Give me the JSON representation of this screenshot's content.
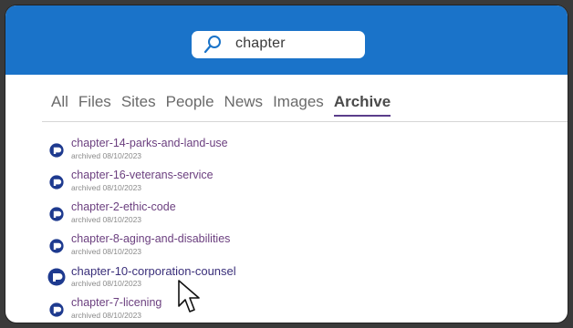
{
  "search": {
    "query": "chapter"
  },
  "tabs": [
    {
      "label": "All"
    },
    {
      "label": "Files"
    },
    {
      "label": "Sites"
    },
    {
      "label": "People"
    },
    {
      "label": "News"
    },
    {
      "label": "Images"
    },
    {
      "label": "Archive",
      "active": true
    }
  ],
  "results": [
    {
      "title": "chapter-14-parks-and-land-use",
      "meta": "archived 08/10/2023"
    },
    {
      "title": "chapter-16-veterans-service",
      "meta": "archived 08/10/2023"
    },
    {
      "title": "chapter-2-ethic-code",
      "meta": "archived 08/10/2023"
    },
    {
      "title": "chapter-8-aging-and-disabilities",
      "meta": "archived 08/10/2023"
    },
    {
      "title": "chapter-10-corporation-counsel",
      "meta": "archived 08/10/2023",
      "hovered": true
    },
    {
      "title": "chapter-7-licening",
      "meta": "archived 08/10/2023"
    }
  ],
  "colors": {
    "header": "#1a73c9",
    "result_title": "#6b3f7f",
    "active_tab_underline": "#5a3d8a"
  },
  "icons": {
    "search": "search-icon",
    "result": "archive-app-icon",
    "cursor": "mouse-pointer-icon"
  }
}
